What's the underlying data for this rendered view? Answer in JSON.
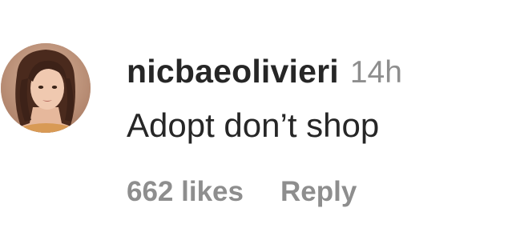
{
  "comment": {
    "username": "nicbaeolivieri",
    "timestamp": "14h",
    "text": "Adopt don’t shop",
    "likes": "662 likes",
    "reply_label": "Reply"
  }
}
